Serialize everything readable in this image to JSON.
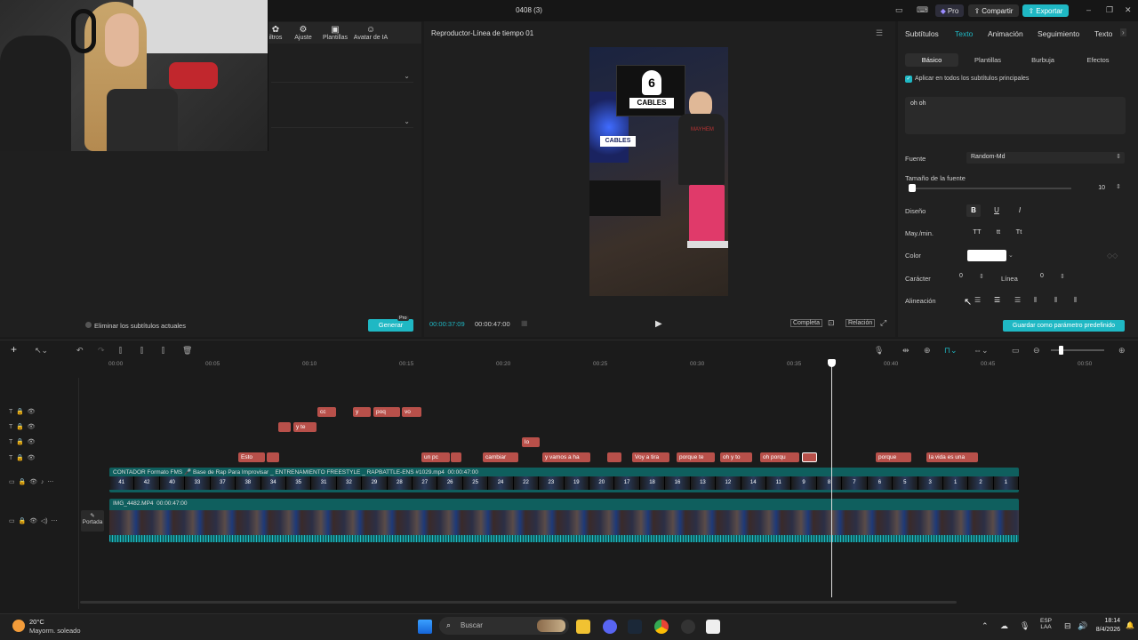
{
  "window": {
    "title": "0408 (3)",
    "pro_label": "Pro",
    "share_label": "Compartir",
    "export_label": "Exportar"
  },
  "toolbar": {
    "tools": [
      {
        "label": "iltros",
        "icon": "filter-icon"
      },
      {
        "label": "Ajuste",
        "icon": "adjust-icon"
      },
      {
        "label": "Plantillas",
        "icon": "templates-icon"
      },
      {
        "label": "Avatar de IA",
        "icon": "avatar-icon"
      }
    ]
  },
  "left_panel": {
    "remove_subtitles_label": "Eliminar los subtítulos actuales",
    "generate_label": "Generar",
    "generate_badge": "Pro"
  },
  "player": {
    "title": "Reproductor-Línea de tiempo 01",
    "current_time": "00:00:37:09",
    "total_time": "00:00:47:00",
    "overlay_number": "6",
    "overlay_text": "CABLES",
    "shirt_text": "MAYHEM",
    "full_label": "Completa",
    "ratio_label": "Relación"
  },
  "right_panel": {
    "tabs": [
      "Subtítulos",
      "Texto",
      "Animación",
      "Seguimiento",
      "Texto"
    ],
    "active_tab": 1,
    "subtabs": [
      "Básico",
      "Plantillas",
      "Burbuja",
      "Efectos"
    ],
    "apply_all_label": "Aplicar en todos los subtítulos principales",
    "text_value": "oh oh",
    "font_label": "Fuente",
    "font_value": "Random-Md",
    "font_size_label": "Tamaño de la fuente",
    "font_size_value": "10",
    "font_size_level": 0.02,
    "design_label": "Diseño",
    "design_buttons": [
      "B",
      "U",
      "I"
    ],
    "case_label": "May./min.",
    "case_buttons": [
      "TT",
      "tt",
      "Tt"
    ],
    "color_label": "Color",
    "color_value": "#ffffff",
    "char_label": "Carácter",
    "char_value": "0",
    "line_label": "Línea",
    "line_value": "0",
    "align_label": "Alineación",
    "save_default_label": "Guardar como parámetro predefinido"
  },
  "timeline": {
    "ruler": [
      "00:00",
      "00:05",
      "00:10",
      "00:15",
      "00:20",
      "00:25",
      "00:30",
      "00:35",
      "00:40",
      "00:45",
      "00:50"
    ],
    "video_clip_title": "CONTADOR Formato FMS 🎤 Base de Rap Para Improvisar _ ENTRENAMIENTO FREESTYLE _ RAPBATTLE-ENS #1029.mp4",
    "video_clip_duration": "00:00:47:00",
    "main_clip_title": "IMG_4482.MP4",
    "main_clip_duration": "00:00:47:00",
    "cover_label": "Portada",
    "subtitle_row4": [
      "Esto",
      "",
      "un pc",
      "",
      "cambiar",
      "y vamos a ha",
      "",
      "Voy a tira",
      "porque te",
      "oh y to",
      "oh porqu",
      "",
      "porque",
      "la vida es una"
    ],
    "subtitle_row1": [
      "cc",
      "y",
      "poq",
      "vo"
    ],
    "subtitle_row2": [
      "",
      "y te"
    ],
    "subtitle_row3": [
      "lo"
    ],
    "frame_numbers": [
      "41",
      "42",
      "40",
      "33",
      "37",
      "38",
      "34",
      "35",
      "31",
      "32",
      "29",
      "28",
      "27",
      "26",
      "25",
      "24",
      "22",
      "23",
      "19",
      "20",
      "17",
      "18",
      "16",
      "13",
      "12",
      "14",
      "11",
      "9",
      "8",
      "7",
      "6",
      "5",
      "3",
      "1",
      "2",
      "1"
    ]
  },
  "taskbar": {
    "weather_temp": "20°C",
    "weather_desc": "Mayorm. soleado",
    "search_placeholder": "Buscar",
    "lang": "ESP",
    "lang_sub": "LAA",
    "time": "18:14",
    "date": "8/4/2026"
  }
}
